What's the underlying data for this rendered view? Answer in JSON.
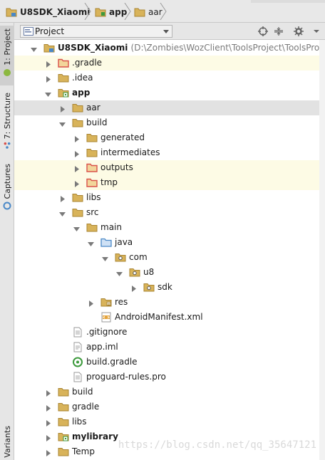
{
  "breadcrumb": {
    "items": [
      {
        "label": "U8SDK_Xiaomi",
        "icon": "project-folder-icon"
      },
      {
        "label": "app",
        "icon": "module-folder-icon"
      },
      {
        "label": "aar",
        "icon": "folder-icon"
      }
    ]
  },
  "side_tabs": [
    {
      "label": "1: Project",
      "icon": "android-icon",
      "active": true
    },
    {
      "label": "7: Structure",
      "icon": "structure-icon",
      "active": false
    },
    {
      "label": "Captures",
      "icon": "camera-icon",
      "active": false
    },
    {
      "label": "Variants",
      "icon": "",
      "active": false
    }
  ],
  "tool_window": {
    "view_selector": "Project",
    "header_icons": [
      "target-icon",
      "collapse-all-icon",
      "gear-icon",
      "hide-icon"
    ]
  },
  "tree": [
    {
      "label": "U8SDK_Xiaomi",
      "path": "(D:\\Zombies\\WozClient\\ToolsProject\\ToolsProject\\",
      "depth": 0,
      "arrow": "down",
      "icon": "project-folder-icon",
      "bold": true,
      "state": ""
    },
    {
      "label": ".gradle",
      "depth": 1,
      "arrow": "right",
      "icon": "folder-red-icon",
      "state": "hl"
    },
    {
      "label": ".idea",
      "depth": 1,
      "arrow": "right",
      "icon": "folder-icon",
      "state": ""
    },
    {
      "label": "app",
      "depth": 1,
      "arrow": "down",
      "icon": "module-folder-icon",
      "bold": true,
      "state": ""
    },
    {
      "label": "aar",
      "depth": 2,
      "arrow": "right",
      "icon": "folder-icon",
      "state": "sel"
    },
    {
      "label": "build",
      "depth": 2,
      "arrow": "down",
      "icon": "folder-icon",
      "state": ""
    },
    {
      "label": "generated",
      "depth": 3,
      "arrow": "right",
      "icon": "folder-icon",
      "state": ""
    },
    {
      "label": "intermediates",
      "depth": 3,
      "arrow": "right",
      "icon": "folder-icon",
      "state": ""
    },
    {
      "label": "outputs",
      "depth": 3,
      "arrow": "right",
      "icon": "folder-red-icon",
      "state": "hl"
    },
    {
      "label": "tmp",
      "depth": 3,
      "arrow": "right",
      "icon": "folder-red-icon",
      "state": "hl"
    },
    {
      "label": "libs",
      "depth": 2,
      "arrow": "right",
      "icon": "folder-icon",
      "state": ""
    },
    {
      "label": "src",
      "depth": 2,
      "arrow": "down",
      "icon": "folder-icon",
      "state": ""
    },
    {
      "label": "main",
      "depth": 3,
      "arrow": "down",
      "icon": "folder-icon",
      "state": ""
    },
    {
      "label": "java",
      "depth": 4,
      "arrow": "down",
      "icon": "source-folder-icon",
      "state": ""
    },
    {
      "label": "com",
      "depth": 5,
      "arrow": "down",
      "icon": "package-icon",
      "state": ""
    },
    {
      "label": "u8",
      "depth": 6,
      "arrow": "down",
      "icon": "package-icon",
      "state": ""
    },
    {
      "label": "sdk",
      "depth": 7,
      "arrow": "right",
      "icon": "package-icon",
      "state": ""
    },
    {
      "label": "res",
      "depth": 4,
      "arrow": "right",
      "icon": "resources-folder-icon",
      "state": ""
    },
    {
      "label": "AndroidManifest.xml",
      "depth": 4,
      "arrow": "",
      "icon": "xml-file-icon",
      "state": ""
    },
    {
      "label": ".gitignore",
      "depth": 2,
      "arrow": "",
      "icon": "text-file-icon",
      "state": ""
    },
    {
      "label": "app.iml",
      "depth": 2,
      "arrow": "",
      "icon": "iml-file-icon",
      "state": ""
    },
    {
      "label": "build.gradle",
      "depth": 2,
      "arrow": "",
      "icon": "gradle-file-icon",
      "state": ""
    },
    {
      "label": "proguard-rules.pro",
      "depth": 2,
      "arrow": "",
      "icon": "text-file-icon",
      "state": ""
    },
    {
      "label": "build",
      "depth": 1,
      "arrow": "right",
      "icon": "folder-icon",
      "state": ""
    },
    {
      "label": "gradle",
      "depth": 1,
      "arrow": "right",
      "icon": "folder-icon",
      "state": ""
    },
    {
      "label": "libs",
      "depth": 1,
      "arrow": "right",
      "icon": "folder-icon",
      "state": ""
    },
    {
      "label": "mylibrary",
      "depth": 1,
      "arrow": "right",
      "icon": "module-folder-icon",
      "bold": true,
      "state": ""
    },
    {
      "label": "Temp",
      "depth": 1,
      "arrow": "right",
      "icon": "folder-icon",
      "state": ""
    }
  ],
  "watermark": "https://blog.csdn.net/qq_35647121",
  "colors": {
    "folder": "#d8b35a",
    "folder_red": "#d9514b",
    "source_folder": "#4a88c7",
    "highlight_row": "#fdfbe5",
    "selected_row": "#e2e2e2"
  }
}
